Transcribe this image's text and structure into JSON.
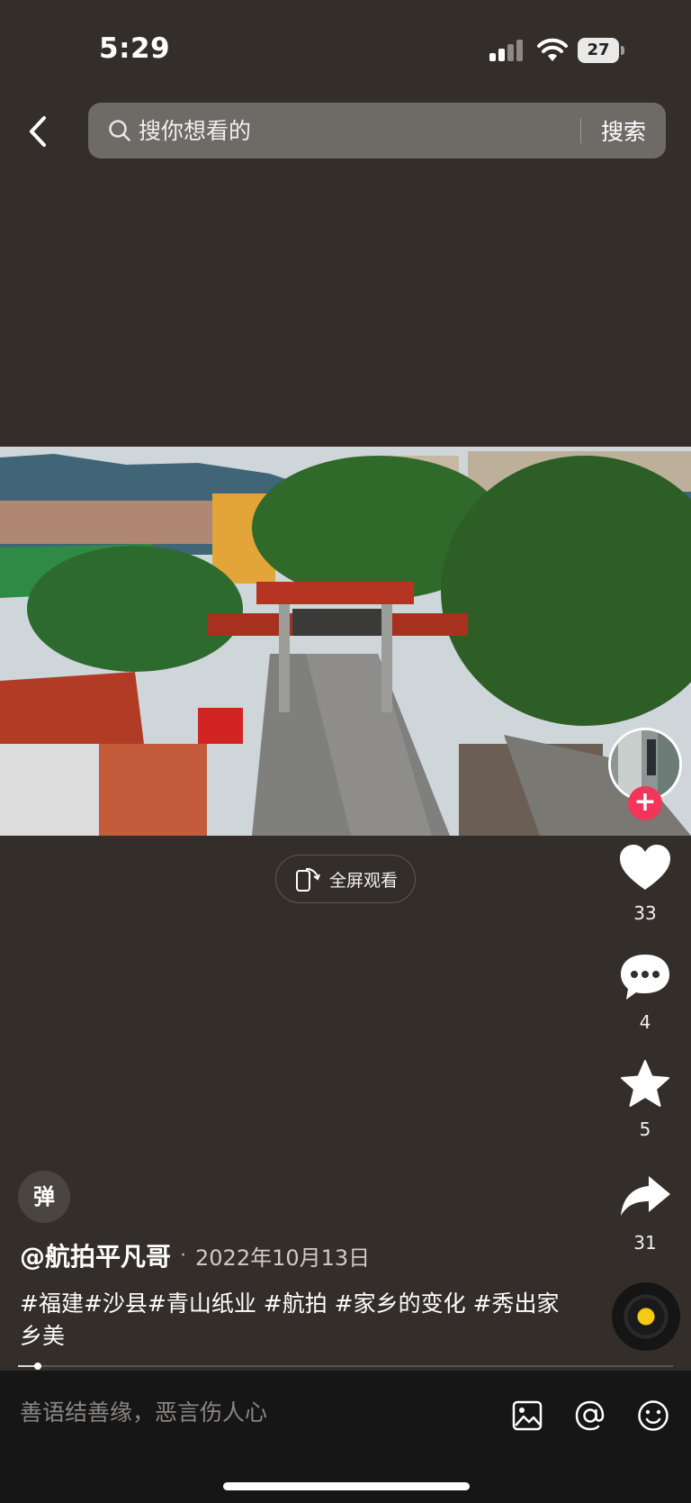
{
  "status_bar": {
    "time": "5:29",
    "battery": "27"
  },
  "search": {
    "placeholder": "搜你想看的",
    "button_label": "搜索"
  },
  "video": {
    "fullscreen_label": "全屏观看"
  },
  "actions": {
    "likes": "33",
    "comments": "4",
    "favorites": "5",
    "shares": "31"
  },
  "post": {
    "danmaku_label": "弹",
    "author": "@航拍平凡哥",
    "separator": "·",
    "date": "2022年10月13日",
    "description": "#福建#沙县#青山纸业 #航拍 #家乡的变化 #秀出家乡美",
    "progress": 0.03
  },
  "comment_bar": {
    "placeholder": "善语结善缘，恶言伤人心"
  },
  "icons": [
    "chevron-left-icon",
    "search-icon",
    "phone-rotate-icon",
    "heart-icon",
    "comment-icon",
    "star-icon",
    "share-icon",
    "image-icon",
    "at-icon",
    "emoji-icon"
  ]
}
